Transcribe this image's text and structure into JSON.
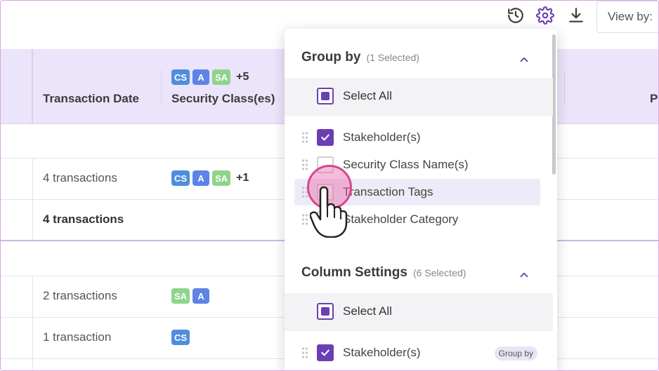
{
  "toolbar": {
    "history_icon": "history-icon",
    "settings_icon": "gear-icon",
    "download_icon": "download-icon",
    "view_by_label": "View by:"
  },
  "table": {
    "header": {
      "transaction_date": "Transaction Date",
      "security_classes": "Security Class(es)",
      "right_partial": "P",
      "badges": [
        "CS",
        "A",
        "SA"
      ],
      "more": "+5"
    },
    "rows": [
      {
        "text": "4 transactions",
        "badges": [
          "CS",
          "A",
          "SA"
        ],
        "more": "+1"
      },
      {
        "text": "4 transactions",
        "bold": true
      },
      {
        "text": "2 transactions",
        "badges": [
          "SA",
          "A"
        ]
      },
      {
        "text": "1 transaction",
        "badges": [
          "CS"
        ]
      }
    ]
  },
  "dropdown": {
    "group_by": {
      "title": "Group by",
      "count": "(1 Selected)",
      "select_all": "Select All",
      "items": [
        {
          "label": "Stakeholder(s)",
          "checked": true
        },
        {
          "label": "Security Class Name(s)",
          "checked": false
        },
        {
          "label": "Transaction Tags",
          "checked": false,
          "hover": true
        },
        {
          "label": "Stakeholder Category",
          "checked": false
        }
      ]
    },
    "column_settings": {
      "title": "Column Settings",
      "count": "(6 Selected)",
      "select_all": "Select All",
      "items": [
        {
          "label": "Stakeholder(s)",
          "checked": true,
          "pill": "Group by"
        }
      ]
    }
  },
  "colors": {
    "accent": "#6b3fb4",
    "header_bg": "#ece4fa",
    "badge_cs": "#4e8ede",
    "badge_a": "#5d84e6",
    "badge_sa": "#8fd48a",
    "click_highlight": "#d9468f"
  }
}
